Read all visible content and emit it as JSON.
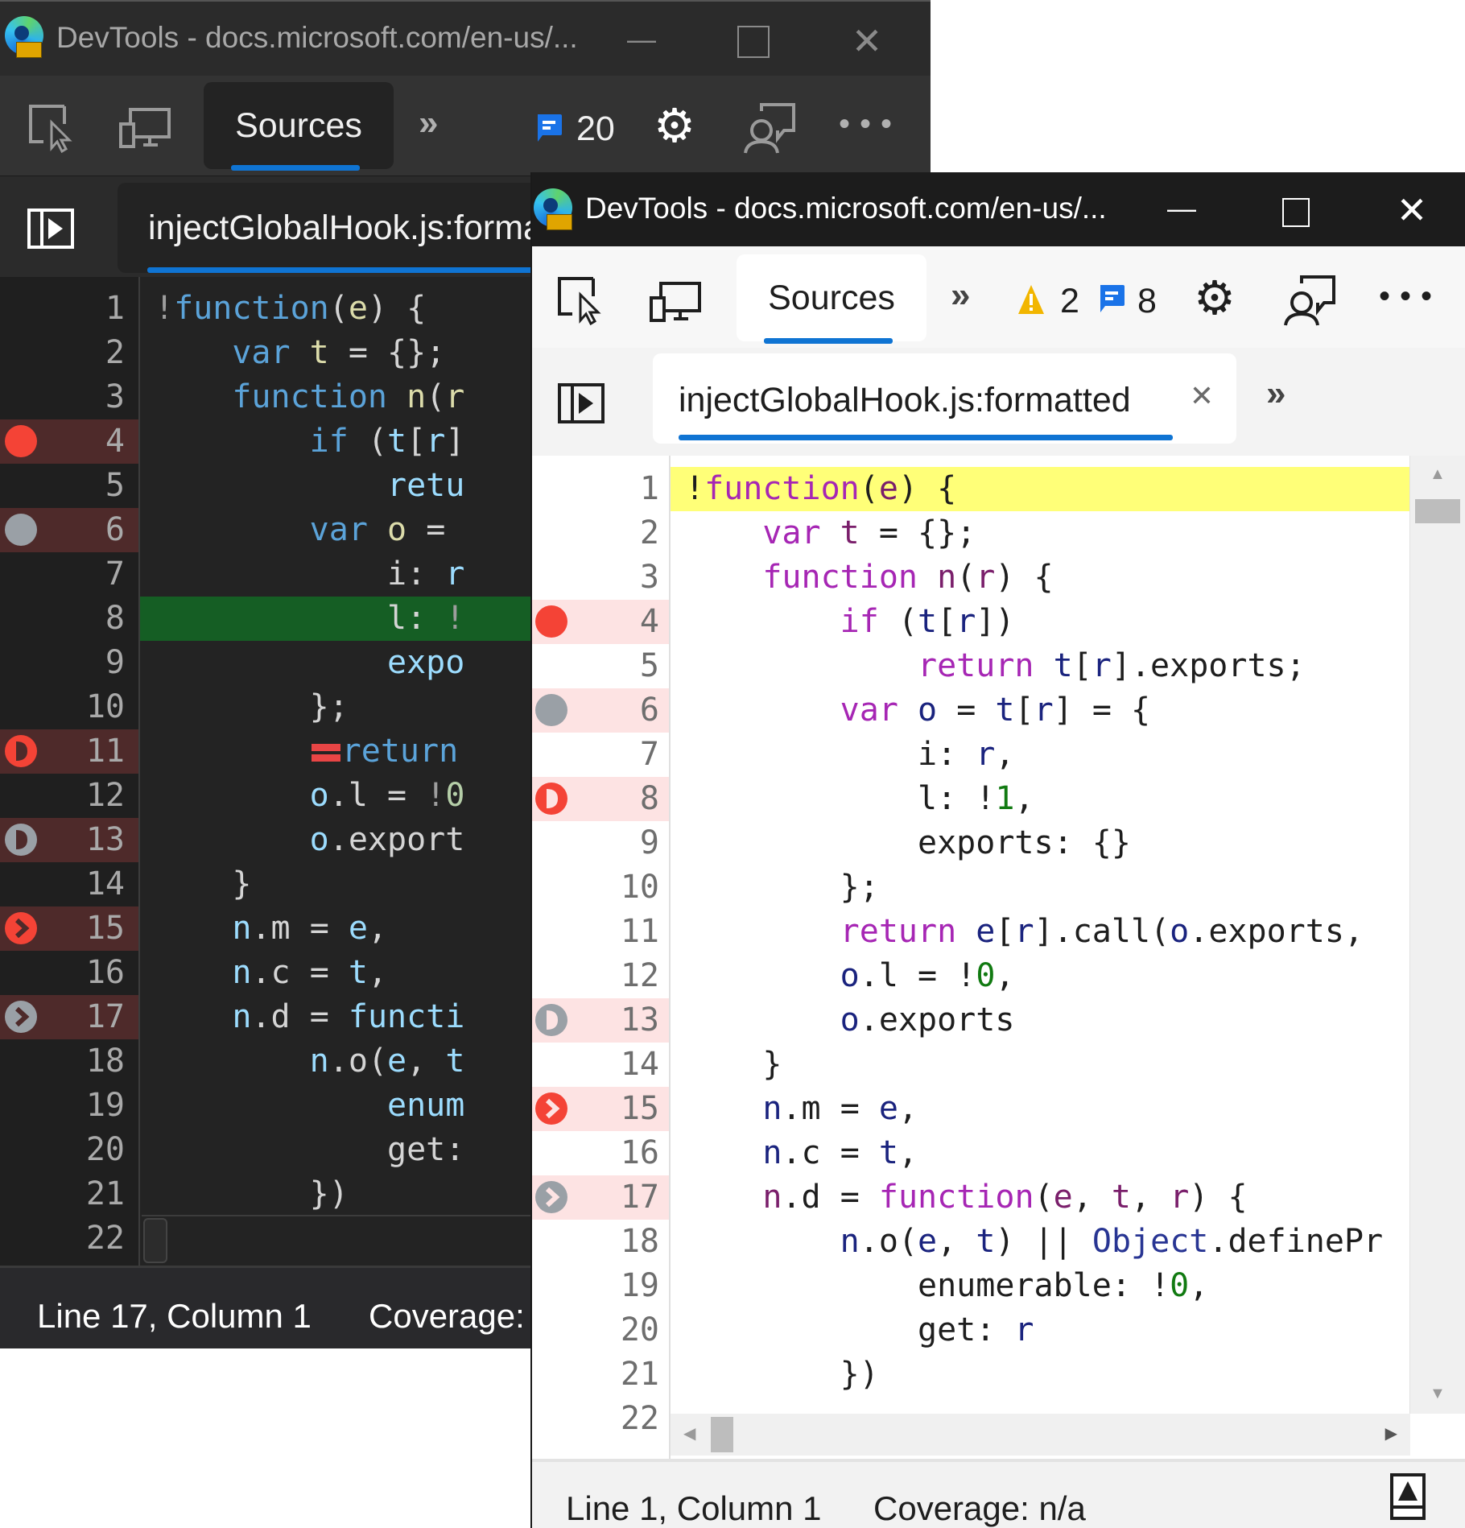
{
  "dark_window": {
    "title": "DevTools - docs.microsoft.com/en-us/...",
    "toolbar": {
      "active_tab": "Sources",
      "message_count": "20",
      "inspect_label": "inspect-element",
      "device_label": "device-emulation"
    },
    "file_tab": {
      "label": "injectGlobalHook.js:formatted"
    },
    "code_lines": [
      {
        "n": "1"
      },
      {
        "n": "2"
      },
      {
        "n": "3"
      },
      {
        "n": "4"
      },
      {
        "n": "5"
      },
      {
        "n": "6"
      },
      {
        "n": "7"
      },
      {
        "n": "8"
      },
      {
        "n": "9"
      },
      {
        "n": "10"
      },
      {
        "n": "11"
      },
      {
        "n": "12"
      },
      {
        "n": "13"
      },
      {
        "n": "14"
      },
      {
        "n": "15"
      },
      {
        "n": "16"
      },
      {
        "n": "17"
      },
      {
        "n": "18"
      },
      {
        "n": "19"
      },
      {
        "n": "20"
      },
      {
        "n": "21"
      },
      {
        "n": "22"
      }
    ],
    "status": {
      "position": "Line 17, Column 1",
      "coverage": "Coverage: n/a"
    }
  },
  "light_window": {
    "title": "DevTools - docs.microsoft.com/en-us/...",
    "toolbar": {
      "active_tab": "Sources",
      "warning_count": "2",
      "message_count": "8"
    },
    "file_tab": {
      "label": "injectGlobalHook.js:formatted"
    },
    "status": {
      "position": "Line 1, Column 1",
      "coverage": "Coverage: n/a"
    }
  },
  "code": {
    "line_numbers": [
      "1",
      "2",
      "3",
      "4",
      "5",
      "6",
      "7",
      "8",
      "9",
      "10",
      "11",
      "12",
      "13",
      "14",
      "15",
      "16",
      "17",
      "18",
      "19",
      "20",
      "21",
      "22"
    ],
    "lines": [
      "!function(e) {",
      "    var t = {};",
      "    function n(r) {",
      "        if (t[r])",
      "            return t[r].exports;",
      "        var o = t[r] = {",
      "            i: r,",
      "            l: !1,",
      "            exports: {}",
      "        };",
      "        return e[r].call(o.exports,",
      "        o.l = !0,",
      "        o.exports",
      "    }",
      "    n.m = e,",
      "    n.c = t,",
      "    n.d = function(e, t, r) {",
      "        n.o(e, t) || Object.definePr",
      "            enumerable: !0,",
      "            get: r",
      "        })",
      ""
    ]
  },
  "breakpoints": {
    "dark": [
      {
        "line": 4,
        "type": "breakpoint",
        "color": "#f44336"
      },
      {
        "line": 6,
        "type": "breakpoint-disabled",
        "color": "#9aa0a6"
      },
      {
        "line": 11,
        "type": "conditional",
        "color": "#f44336"
      },
      {
        "line": 13,
        "type": "conditional-disabled",
        "color": "#9aa0a6"
      },
      {
        "line": 15,
        "type": "logpoint",
        "color": "#f44336"
      },
      {
        "line": 17,
        "type": "logpoint-disabled",
        "color": "#9aa0a6"
      }
    ],
    "light": [
      {
        "line": 4,
        "type": "breakpoint",
        "color": "#f44336"
      },
      {
        "line": 6,
        "type": "breakpoint-disabled",
        "color": "#9aa0a6"
      },
      {
        "line": 8,
        "type": "conditional",
        "color": "#f44336"
      },
      {
        "line": 13,
        "type": "conditional-disabled",
        "color": "#9aa0a6"
      },
      {
        "line": 15,
        "type": "logpoint",
        "color": "#f44336"
      },
      {
        "line": 17,
        "type": "logpoint-disabled",
        "color": "#9aa0a6"
      }
    ],
    "dark_execution_line": 8,
    "light_execution_line": 1
  },
  "colors": {
    "accent": "#0f74d3",
    "breakpoint_active": "#f44336",
    "breakpoint_inactive": "#9aa0a6",
    "warning": "#f2b600",
    "message": "#1a73e8",
    "dark_exec_highlight": "#155e24",
    "light_exec_highlight": "#ffff78"
  }
}
